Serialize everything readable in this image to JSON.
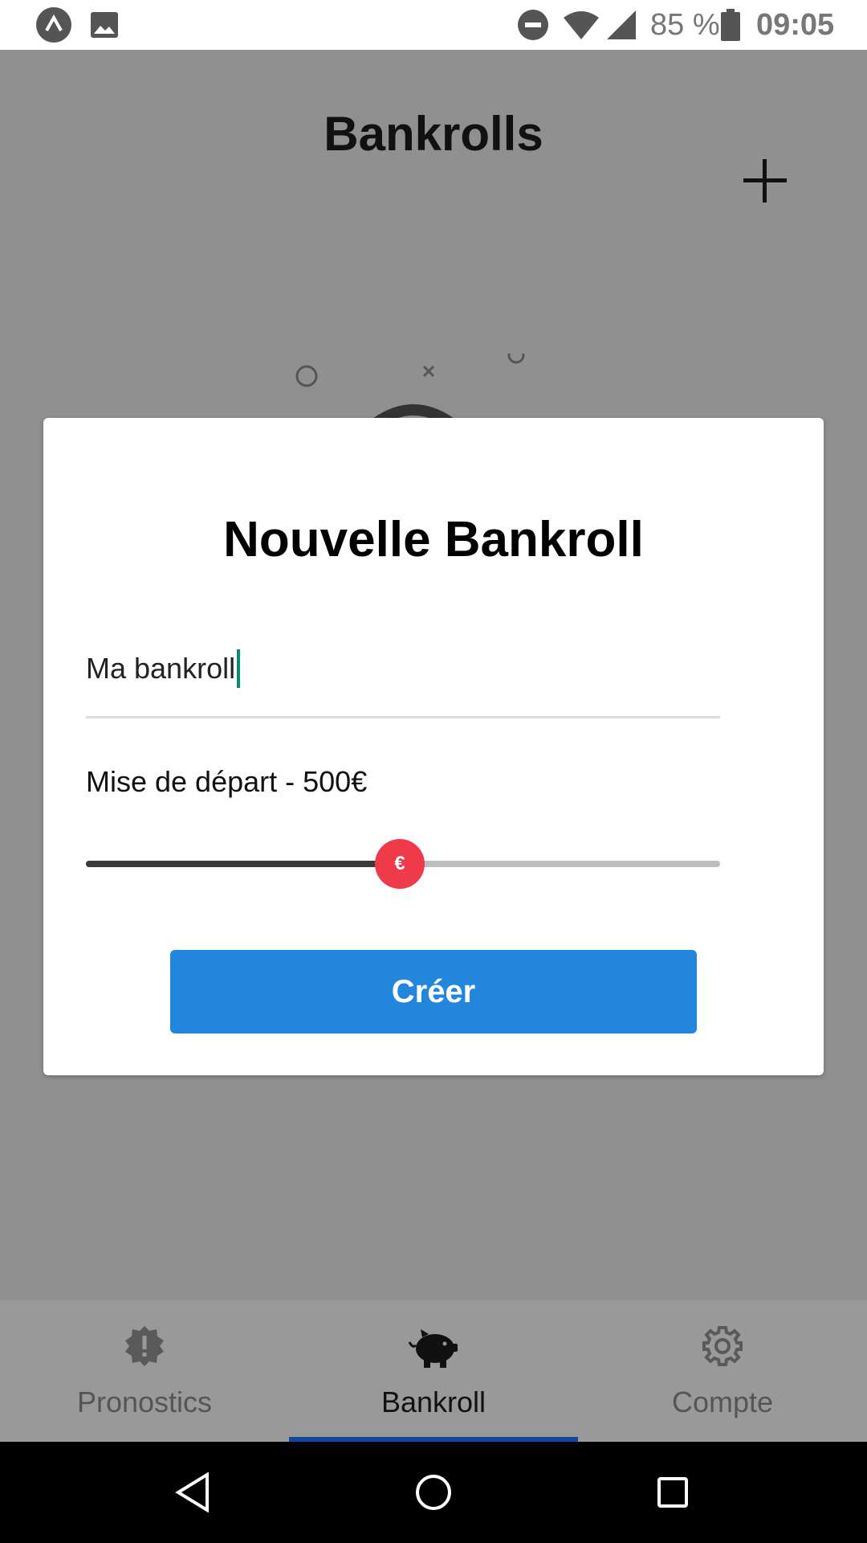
{
  "status_bar": {
    "icons": [
      "app-icon",
      "image-icon",
      "do-not-disturb-icon",
      "wifi-icon",
      "signal-icon",
      "battery-icon"
    ],
    "battery_percent": "85 %",
    "time": "09:05"
  },
  "header": {
    "title": "Bankrolls",
    "add_icon": "plus-icon"
  },
  "modal": {
    "title": "Nouvelle Bankroll",
    "name_value": "Ma bankroll",
    "stake_label": "Mise de départ - 500€",
    "slider_fraction": 0.495,
    "slider_thumb_symbol": "€",
    "create_label": "Créer"
  },
  "tabs": {
    "items": [
      {
        "label": "Pronostics",
        "icon": "alert-badge-icon",
        "active": false
      },
      {
        "label": "Bankroll",
        "icon": "piggy-bank-icon",
        "active": true
      },
      {
        "label": "Compte",
        "icon": "gear-icon",
        "active": false
      }
    ]
  },
  "colors": {
    "accent": "#2186dc",
    "slider_thumb": "#ef3a4a",
    "active_tab_indicator": "#1249a0",
    "overlay": "#909090"
  }
}
